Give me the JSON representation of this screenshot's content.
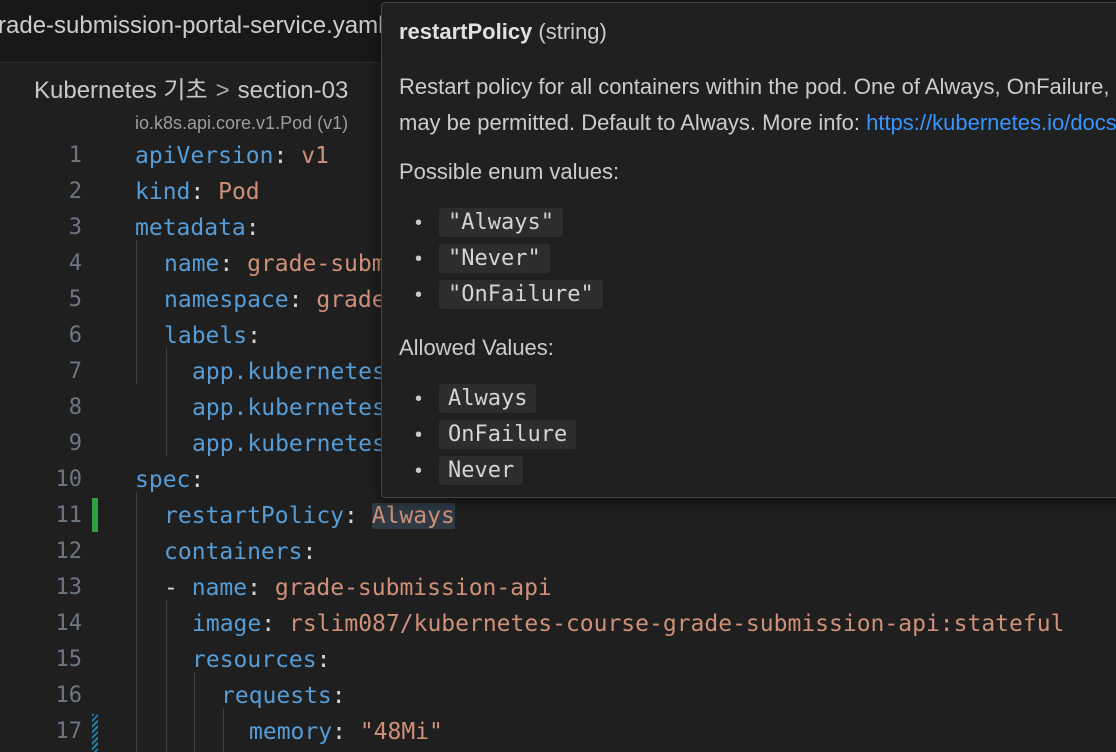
{
  "tab": {
    "title": "rade-submission-portal-service.yaml"
  },
  "breadcrumb": {
    "folder": "Kubernetes 기초",
    "separator": ">",
    "subfolder": "section-03"
  },
  "codelens": {
    "text": "io.k8s.api.core.v1.Pod (v1)"
  },
  "editor": {
    "lines": [
      {
        "num": "1",
        "key": "apiVersion",
        "colon": ":",
        "value": "v1"
      },
      {
        "num": "2",
        "key": "kind",
        "colon": ":",
        "value": "Pod"
      },
      {
        "num": "3",
        "key": "metadata",
        "colon": ":",
        "value": ""
      },
      {
        "num": "4",
        "key": "name",
        "colon": ":",
        "value": "grade-submission-portal"
      },
      {
        "num": "5",
        "key": "namespace",
        "colon": ":",
        "value": "grade-submission"
      },
      {
        "num": "6",
        "key": "labels",
        "colon": ":",
        "value": ""
      },
      {
        "num": "7",
        "key": "app.kubernetes.io/name",
        "colon": ":",
        "value": ""
      },
      {
        "num": "8",
        "key": "app.kubernetes.io/component",
        "colon": ":",
        "value": ""
      },
      {
        "num": "9",
        "key": "app.kubernetes.io/instance",
        "colon": ":",
        "value": ""
      },
      {
        "num": "10",
        "key": "spec",
        "colon": ":",
        "value": ""
      },
      {
        "num": "11",
        "key": "restartPolicy",
        "colon": ":",
        "value": "Always"
      },
      {
        "num": "12",
        "key": "containers",
        "colon": ":",
        "value": ""
      },
      {
        "num": "13",
        "dash": "-",
        "key": "name",
        "colon": ":",
        "value": "grade-submission-api"
      },
      {
        "num": "14",
        "key": "image",
        "colon": ":",
        "value": "rslim087/kubernetes-course-grade-submission-api:stateful"
      },
      {
        "num": "15",
        "key": "resources",
        "colon": ":",
        "value": ""
      },
      {
        "num": "16",
        "key": "requests",
        "colon": ":",
        "value": ""
      },
      {
        "num": "17",
        "key": "memory",
        "colon": ":",
        "value": "\"48Mi\""
      }
    ]
  },
  "hover": {
    "name": "restartPolicy",
    "type": "(string)",
    "desc_line1": "Restart policy for all containers within the pod. One of Always, OnFailure, Never. In some contexts, only a subset of those values",
    "desc_line2_pre": "may be permitted. Default to Always. More info: ",
    "desc_link": "https://kubernetes.io/docs/concepts/workloads/pods/pod-lifecycle/#restart-policy",
    "enum_heading": "Possible enum values:",
    "enum_values": [
      "\"Always\"",
      "\"Never\"",
      "\"OnFailure\""
    ],
    "allowed_heading": "Allowed Values:",
    "allowed_values": [
      "Always",
      "OnFailure",
      "Never"
    ]
  }
}
